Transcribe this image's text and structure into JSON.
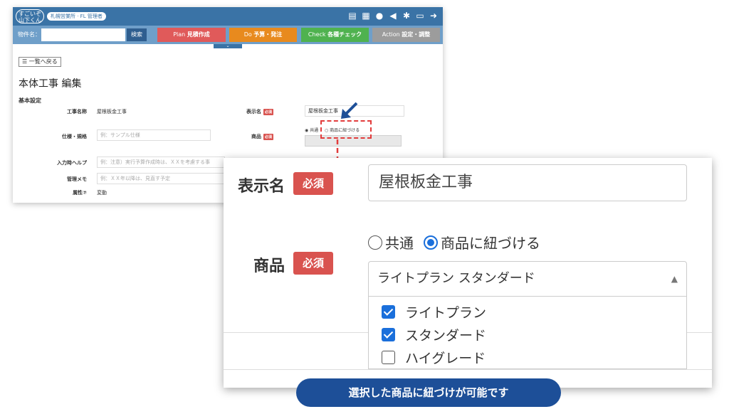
{
  "header": {
    "logo_text": "すごいぞ 山下くん",
    "user_badge": "札幌営業所 · FL 管理者",
    "icons": [
      "document-icon",
      "calendar-icon",
      "chat-icon",
      "megaphone-icon",
      "gear-icon",
      "folder-icon",
      "logout-icon"
    ]
  },
  "search": {
    "label": "物件名：",
    "value": "",
    "button": "検索"
  },
  "stages": [
    {
      "en": "Plan",
      "ja": "見積作成",
      "color": "#e05a5a"
    },
    {
      "en": "Do",
      "ja": "予算・発注",
      "color": "#e88a1e"
    },
    {
      "en": "Check",
      "ja": "各種チェック",
      "color": "#4fb24f"
    },
    {
      "en": "Action",
      "ja": "設定・調整",
      "color": "#9c9c9c"
    }
  ],
  "back_button": "☰ 一覧へ戻る",
  "page_title": "本体工事 編集",
  "section_title": "基本設定",
  "form": {
    "work_name_label": "工事名称",
    "work_name_value": "屋根板金工事",
    "display_name_label": "表示名",
    "display_name_value": "屋根板金工事",
    "required_label": "必須",
    "spec_label": "仕様・規格",
    "spec_placeholder": "例：サンプル仕様",
    "product_label": "商品",
    "radio_common": "共通",
    "radio_link": "商品に紐づける",
    "help_label": "入力時ヘルプ",
    "help_placeholder": "例：注意）実行予算作成時は、ＸＸを考慮する事",
    "memo_label": "管理メモ",
    "memo_placeholder": "例：ＸＸ年以降は、見直す予定",
    "attr_label": "属性⑦",
    "attr_value": "変動"
  },
  "zoom": {
    "display_name_label": "表示名",
    "required_label": "必須",
    "display_name_value": "屋根板金工事",
    "radio_common": "共通",
    "radio_link": "商品に紐づける",
    "product_label": "商品",
    "select_value": "ライトプラン スタンダード",
    "options": [
      {
        "label": "ライトプラン",
        "checked": true
      },
      {
        "label": "スタンダード",
        "checked": true
      },
      {
        "label": "ハイグレード",
        "checked": false
      }
    ]
  },
  "caption": "選択した商品に紐づけが可能です",
  "colors": {
    "header": "#3a73a6",
    "required": "#d9534f",
    "accent": "#1a6fdb",
    "highlight": "#e23c3c",
    "caption": "#1d4f98"
  }
}
